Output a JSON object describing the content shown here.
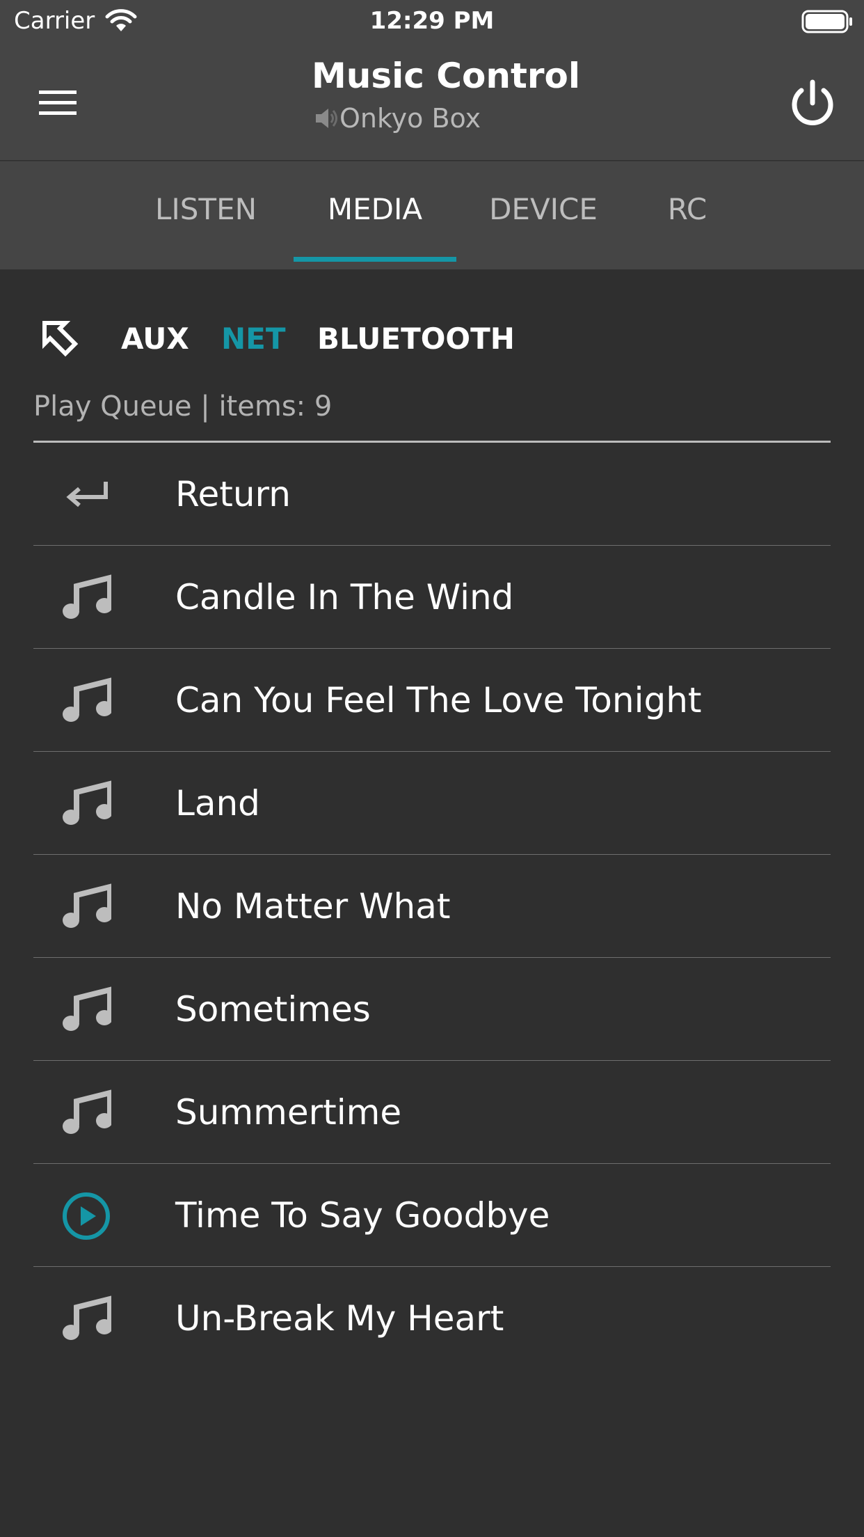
{
  "status_bar": {
    "carrier": "Carrier",
    "time": "12:29 PM"
  },
  "header": {
    "title": "Music Control",
    "device": "Onkyo Box"
  },
  "tabs": [
    {
      "label": "LISTEN",
      "active": false
    },
    {
      "label": "MEDIA",
      "active": true
    },
    {
      "label": "DEVICE",
      "active": false
    },
    {
      "label": "RC",
      "active": false
    }
  ],
  "sources": [
    {
      "label": "AUX",
      "active": false
    },
    {
      "label": "NET",
      "active": true
    },
    {
      "label": "BLUETOOTH",
      "active": false
    }
  ],
  "queue": {
    "label": "Play Queue | items: 9",
    "items": [
      {
        "label": "Return",
        "icon": "return-arrow-icon"
      },
      {
        "label": "Candle In The Wind",
        "icon": "music-note-icon"
      },
      {
        "label": "Can You Feel The Love Tonight",
        "icon": "music-note-icon"
      },
      {
        "label": "Land",
        "icon": "music-note-icon"
      },
      {
        "label": "No Matter What",
        "icon": "music-note-icon"
      },
      {
        "label": "Sometimes",
        "icon": "music-note-icon"
      },
      {
        "label": "Summertime",
        "icon": "music-note-icon"
      },
      {
        "label": "Time To Say Goodbye",
        "icon": "play-circle-icon"
      },
      {
        "label": "Un-Break My Heart",
        "icon": "music-note-icon"
      }
    ]
  },
  "colors": {
    "accent": "#1596a6",
    "background": "#2f2f2f",
    "toolbar": "#454545",
    "icon_gray": "#bdbdbd"
  }
}
